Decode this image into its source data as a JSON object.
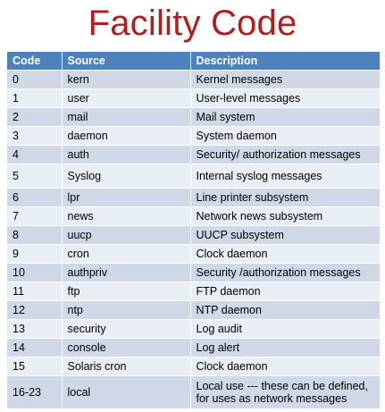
{
  "title": "Facility Code",
  "headers": [
    "Code",
    "Source",
    "Description"
  ],
  "rows": [
    {
      "code": "0",
      "source": "kern",
      "description": "Kernel messages"
    },
    {
      "code": "1",
      "source": "user",
      "description": "User-level messages"
    },
    {
      "code": "2",
      "source": "mail",
      "description": "Mail system"
    },
    {
      "code": "3",
      "source": "daemon",
      "description": "System daemon"
    },
    {
      "code": "4",
      "source": "auth",
      "description": "Security/ authorization messages"
    },
    {
      "code": "5",
      "source": "Syslog",
      "description": "Internal syslog messages"
    },
    {
      "code": "6",
      "source": "lpr",
      "description": "Line printer subsystem"
    },
    {
      "code": "7",
      "source": "news",
      "description": "Network news subsystem"
    },
    {
      "code": "8",
      "source": "uucp",
      "description": "UUCP subsystem"
    },
    {
      "code": "9",
      "source": "cron",
      "description": "Clock daemon"
    },
    {
      "code": "10",
      "source": "authpriv",
      "description": "Security /authorization messages"
    },
    {
      "code": "11",
      "source": "ftp",
      "description": "FTP daemon"
    },
    {
      "code": "12",
      "source": "ntp",
      "description": "NTP daemon"
    },
    {
      "code": "13",
      "source": "security",
      "description": "Log audit"
    },
    {
      "code": "14",
      "source": "console",
      "description": "Log alert"
    },
    {
      "code": "15",
      "source": "Solaris cron",
      "description": "Clock daemon"
    },
    {
      "code": "16-23",
      "source": "local",
      "description": "Local use --- these can be defined, for uses as network messages"
    }
  ],
  "colors": {
    "title": "#b01e1e",
    "header": "#4f81bd",
    "row_odd": "#d0d8e8",
    "row_even": "#e9edf4"
  }
}
